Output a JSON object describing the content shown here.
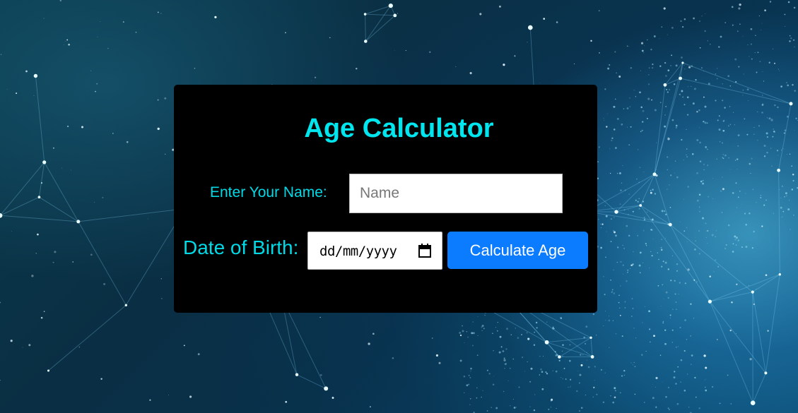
{
  "app": {
    "title": "Age Calculator"
  },
  "form": {
    "name_label": "Enter Your Name:",
    "name_placeholder": "Name",
    "name_value": "",
    "dob_label": "Date of Birth:",
    "dob_placeholder": "dd/mm/yyyy",
    "dob_icon": "calendar-icon",
    "submit_label": "Calculate Age"
  },
  "colors": {
    "accent_text": "#00e5ee",
    "button": "#0b7bff",
    "card_background": "#000000"
  }
}
